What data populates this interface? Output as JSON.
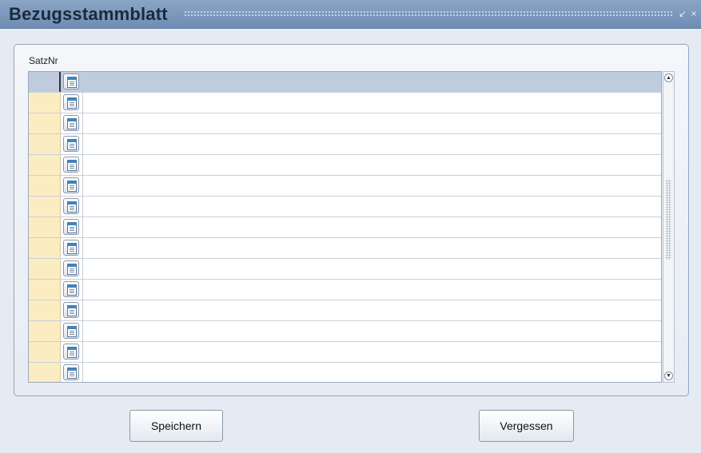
{
  "window": {
    "title": "Bezugsstammblatt",
    "minimize_icon": "↙",
    "close_icon": "×"
  },
  "grid": {
    "column_label": "SatzNr",
    "row_count": 15,
    "rows": [
      "",
      "",
      "",
      "",
      "",
      "",
      "",
      "",
      "",
      "",
      "",
      "",
      "",
      "",
      ""
    ]
  },
  "scrollbar": {
    "up_icon": "▲",
    "down_icon": "▼"
  },
  "buttons": {
    "save_label": "Speichern",
    "cancel_label": "Vergessen"
  },
  "colors": {
    "titlebar": "#7b97bc",
    "row_number_cell": "#fbecc2",
    "selected_row": "#bfccdd"
  }
}
